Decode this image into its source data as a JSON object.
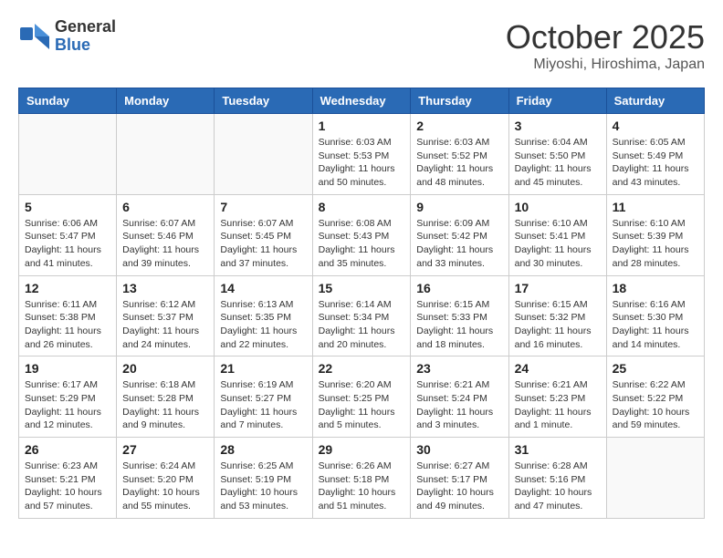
{
  "logo": {
    "line1": "General",
    "line2": "Blue"
  },
  "title": "October 2025",
  "location": "Miyoshi, Hiroshima, Japan",
  "weekdays": [
    "Sunday",
    "Monday",
    "Tuesday",
    "Wednesday",
    "Thursday",
    "Friday",
    "Saturday"
  ],
  "weeks": [
    [
      {
        "day": "",
        "info": ""
      },
      {
        "day": "",
        "info": ""
      },
      {
        "day": "",
        "info": ""
      },
      {
        "day": "1",
        "info": "Sunrise: 6:03 AM\nSunset: 5:53 PM\nDaylight: 11 hours\nand 50 minutes."
      },
      {
        "day": "2",
        "info": "Sunrise: 6:03 AM\nSunset: 5:52 PM\nDaylight: 11 hours\nand 48 minutes."
      },
      {
        "day": "3",
        "info": "Sunrise: 6:04 AM\nSunset: 5:50 PM\nDaylight: 11 hours\nand 45 minutes."
      },
      {
        "day": "4",
        "info": "Sunrise: 6:05 AM\nSunset: 5:49 PM\nDaylight: 11 hours\nand 43 minutes."
      }
    ],
    [
      {
        "day": "5",
        "info": "Sunrise: 6:06 AM\nSunset: 5:47 PM\nDaylight: 11 hours\nand 41 minutes."
      },
      {
        "day": "6",
        "info": "Sunrise: 6:07 AM\nSunset: 5:46 PM\nDaylight: 11 hours\nand 39 minutes."
      },
      {
        "day": "7",
        "info": "Sunrise: 6:07 AM\nSunset: 5:45 PM\nDaylight: 11 hours\nand 37 minutes."
      },
      {
        "day": "8",
        "info": "Sunrise: 6:08 AM\nSunset: 5:43 PM\nDaylight: 11 hours\nand 35 minutes."
      },
      {
        "day": "9",
        "info": "Sunrise: 6:09 AM\nSunset: 5:42 PM\nDaylight: 11 hours\nand 33 minutes."
      },
      {
        "day": "10",
        "info": "Sunrise: 6:10 AM\nSunset: 5:41 PM\nDaylight: 11 hours\nand 30 minutes."
      },
      {
        "day": "11",
        "info": "Sunrise: 6:10 AM\nSunset: 5:39 PM\nDaylight: 11 hours\nand 28 minutes."
      }
    ],
    [
      {
        "day": "12",
        "info": "Sunrise: 6:11 AM\nSunset: 5:38 PM\nDaylight: 11 hours\nand 26 minutes."
      },
      {
        "day": "13",
        "info": "Sunrise: 6:12 AM\nSunset: 5:37 PM\nDaylight: 11 hours\nand 24 minutes."
      },
      {
        "day": "14",
        "info": "Sunrise: 6:13 AM\nSunset: 5:35 PM\nDaylight: 11 hours\nand 22 minutes."
      },
      {
        "day": "15",
        "info": "Sunrise: 6:14 AM\nSunset: 5:34 PM\nDaylight: 11 hours\nand 20 minutes."
      },
      {
        "day": "16",
        "info": "Sunrise: 6:15 AM\nSunset: 5:33 PM\nDaylight: 11 hours\nand 18 minutes."
      },
      {
        "day": "17",
        "info": "Sunrise: 6:15 AM\nSunset: 5:32 PM\nDaylight: 11 hours\nand 16 minutes."
      },
      {
        "day": "18",
        "info": "Sunrise: 6:16 AM\nSunset: 5:30 PM\nDaylight: 11 hours\nand 14 minutes."
      }
    ],
    [
      {
        "day": "19",
        "info": "Sunrise: 6:17 AM\nSunset: 5:29 PM\nDaylight: 11 hours\nand 12 minutes."
      },
      {
        "day": "20",
        "info": "Sunrise: 6:18 AM\nSunset: 5:28 PM\nDaylight: 11 hours\nand 9 minutes."
      },
      {
        "day": "21",
        "info": "Sunrise: 6:19 AM\nSunset: 5:27 PM\nDaylight: 11 hours\nand 7 minutes."
      },
      {
        "day": "22",
        "info": "Sunrise: 6:20 AM\nSunset: 5:25 PM\nDaylight: 11 hours\nand 5 minutes."
      },
      {
        "day": "23",
        "info": "Sunrise: 6:21 AM\nSunset: 5:24 PM\nDaylight: 11 hours\nand 3 minutes."
      },
      {
        "day": "24",
        "info": "Sunrise: 6:21 AM\nSunset: 5:23 PM\nDaylight: 11 hours\nand 1 minute."
      },
      {
        "day": "25",
        "info": "Sunrise: 6:22 AM\nSunset: 5:22 PM\nDaylight: 10 hours\nand 59 minutes."
      }
    ],
    [
      {
        "day": "26",
        "info": "Sunrise: 6:23 AM\nSunset: 5:21 PM\nDaylight: 10 hours\nand 57 minutes."
      },
      {
        "day": "27",
        "info": "Sunrise: 6:24 AM\nSunset: 5:20 PM\nDaylight: 10 hours\nand 55 minutes."
      },
      {
        "day": "28",
        "info": "Sunrise: 6:25 AM\nSunset: 5:19 PM\nDaylight: 10 hours\nand 53 minutes."
      },
      {
        "day": "29",
        "info": "Sunrise: 6:26 AM\nSunset: 5:18 PM\nDaylight: 10 hours\nand 51 minutes."
      },
      {
        "day": "30",
        "info": "Sunrise: 6:27 AM\nSunset: 5:17 PM\nDaylight: 10 hours\nand 49 minutes."
      },
      {
        "day": "31",
        "info": "Sunrise: 6:28 AM\nSunset: 5:16 PM\nDaylight: 10 hours\nand 47 minutes."
      },
      {
        "day": "",
        "info": ""
      }
    ]
  ]
}
